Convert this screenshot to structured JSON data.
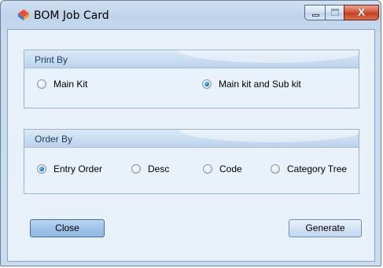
{
  "window": {
    "title": "BOM Job Card",
    "close_glyph": "X",
    "icon": "bom-app-icon"
  },
  "print_by": {
    "legend": "Print By",
    "options": [
      {
        "label": "Main Kit",
        "selected": false
      },
      {
        "label": "Main kit and Sub kit",
        "selected": true
      }
    ]
  },
  "order_by": {
    "legend": "Order By",
    "options": [
      {
        "label": "Entry Order",
        "selected": true
      },
      {
        "label": "Desc",
        "selected": false
      },
      {
        "label": "Code",
        "selected": false
      },
      {
        "label": "Category Tree",
        "selected": false
      }
    ]
  },
  "buttons": {
    "close_label": "Close",
    "generate_label": "Generate"
  },
  "colors": {
    "accent": "#1f7fc9",
    "close_button": "#c3401f"
  }
}
